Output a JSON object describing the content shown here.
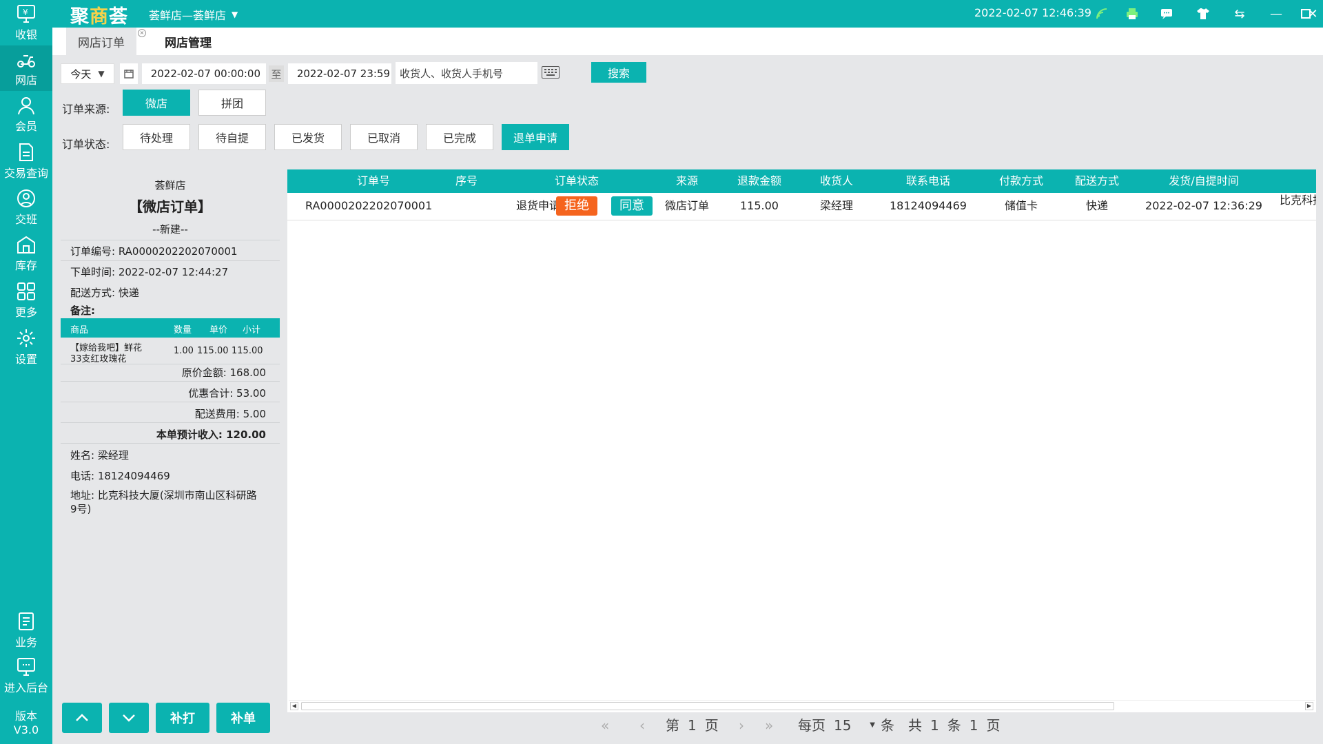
{
  "sidebar": {
    "items": [
      {
        "label": "收银",
        "icon": "cashier-monitor-icon"
      },
      {
        "label": "网店",
        "icon": "delivery-scooter-icon"
      },
      {
        "label": "会员",
        "icon": "member-person-icon"
      },
      {
        "label": "交易查询",
        "icon": "document-query-icon"
      },
      {
        "label": "交班",
        "icon": "handover-user-icon"
      },
      {
        "label": "库存",
        "icon": "warehouse-icon"
      },
      {
        "label": "更多",
        "icon": "grid-more-icon"
      },
      {
        "label": "设置",
        "icon": "gear-icon"
      }
    ],
    "bottom_items": [
      {
        "label": "业务",
        "icon": "business-book-icon"
      },
      {
        "label": "进入后台",
        "icon": "backend-monitor-icon"
      }
    ],
    "version_label": "版本",
    "version_value": "V3.0"
  },
  "topbar": {
    "logo": "聚商荟",
    "store": "荟鲜店—荟鲜店",
    "datetime": "2022-02-07 12:46:39"
  },
  "tabs": [
    "网店订单",
    "网店管理"
  ],
  "filters": {
    "range_select": "今天",
    "start_date": "2022-02-07 00:00:00",
    "to_label": "至",
    "end_date": "2022-02-07 23:59",
    "search_placeholder": "收货人、收货人手机号",
    "search_button": "搜索",
    "source_label": "订单来源:",
    "sources": [
      "微店",
      "拼团"
    ],
    "status_label": "订单状态:",
    "statuses": [
      "待处理",
      "待自提",
      "已发货",
      "已取消",
      "已完成",
      "退单申请"
    ]
  },
  "receipt": {
    "store_name": "荟鲜店",
    "title": "【微店订单】",
    "subtitle": "--新建--",
    "order_no": "订单编号:  RA0000202202070001",
    "order_time": "下单时间:  2022-02-07 12:44:27",
    "delivery": "配送方式:  快递",
    "remark": "备注:",
    "item_headers": [
      "商品",
      "数量",
      "单价",
      "小计"
    ],
    "item": {
      "name_line1": "【嫁给我吧】鲜花",
      "name_line2": "33支红玫瑰花",
      "qty": "1.00",
      "price": "115.00",
      "subtotal": "115.00"
    },
    "original_amount": "原价金额:  168.00",
    "discount_total": "优惠合计:  53.00",
    "delivery_fee": "配送费用:  5.00",
    "expected_income": "本单预计收入:  120.00",
    "name": "姓名:  梁经理",
    "phone": "电话:  18124094469",
    "address_line1": "地址:  比克科技大厦(深圳市南山区科研路",
    "address_line2": "9号)"
  },
  "bottom_buttons": {
    "reprint": "补打",
    "supplement": "补单"
  },
  "table": {
    "headers": [
      "订单号",
      "序号",
      "订单状态",
      "来源",
      "退款金额",
      "收货人",
      "联系电话",
      "付款方式",
      "配送方式",
      "发货/自提时间"
    ],
    "row": {
      "order_no": "RA0000202202070001",
      "status": "退货申请",
      "reject": "拒绝",
      "agree": "同意",
      "source": "微店订单",
      "refund": "115.00",
      "receiver": "梁经理",
      "phone": "18124094469",
      "payment": "储值卡",
      "delivery": "快递",
      "time": "2022-02-07 12:36:29",
      "address_partial": "比克科技"
    }
  },
  "pager": {
    "page_prefix": "第",
    "page": "1",
    "page_suffix": "页",
    "per_page_label": "每页",
    "per_page": "15",
    "items_unit": "条",
    "total_label": "共",
    "total_items": "1",
    "total_pages": "1"
  },
  "colors": {
    "accent": "#0bb3b0",
    "reject": "#f5641e",
    "agree": "#0bb3b0"
  }
}
